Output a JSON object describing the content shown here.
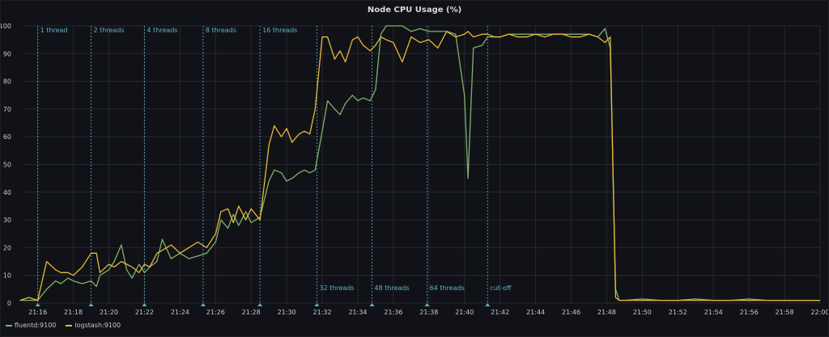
{
  "chart_data": {
    "type": "line",
    "title": "Node CPU Usage (%)",
    "xlabel": "",
    "ylabel": "",
    "xlim": [
      21.2,
      22.0
    ],
    "ylim": [
      0,
      100
    ],
    "yticks": [
      0,
      10,
      20,
      30,
      40,
      50,
      60,
      70,
      80,
      90,
      100
    ],
    "xticks": [
      "21:16",
      "21:18",
      "21:20",
      "21:22",
      "21:24",
      "21:26",
      "21:28",
      "21:30",
      "21:32",
      "21:34",
      "21:36",
      "21:38",
      "21:40",
      "21:42",
      "21:44",
      "21:46",
      "21:48",
      "21:50",
      "21:52",
      "21:54",
      "21:56",
      "21:58",
      "22:00"
    ],
    "grid": true,
    "legend_position": "bottom-left",
    "annotations": [
      {
        "time": "21:16",
        "label": "1 thread",
        "label_pos": "top"
      },
      {
        "time": "21:19",
        "label": "2 threads",
        "label_pos": "top"
      },
      {
        "time": "21:22",
        "label": "4 threads",
        "label_pos": "top"
      },
      {
        "time": "21:25.3",
        "label": "8 threads",
        "label_pos": "top"
      },
      {
        "time": "21:28.5",
        "label": "16 threads",
        "label_pos": "top"
      },
      {
        "time": "21:31.7",
        "label": "32 threads",
        "label_pos": "bottom"
      },
      {
        "time": "21:34.8",
        "label": "48 threads",
        "label_pos": "bottom"
      },
      {
        "time": "21:37.9",
        "label": "64 threads",
        "label_pos": "bottom"
      },
      {
        "time": "21:41.3",
        "label": "cut-off",
        "label_pos": "bottom"
      }
    ],
    "series": [
      {
        "name": "fluentd:9100",
        "color": "#7eb26d",
        "points": [
          [
            "21:15",
            1
          ],
          [
            "21:15.5",
            1
          ],
          [
            "21:16",
            1
          ],
          [
            "21:16.5",
            5
          ],
          [
            "21:17",
            8
          ],
          [
            "21:17.3",
            7
          ],
          [
            "21:17.7",
            9
          ],
          [
            "21:18",
            8
          ],
          [
            "21:18.5",
            7
          ],
          [
            "21:19",
            8
          ],
          [
            "21:19.3",
            6
          ],
          [
            "21:19.5",
            10
          ],
          [
            "21:20",
            12
          ],
          [
            "21:20.3",
            15
          ],
          [
            "21:20.7",
            21
          ],
          [
            "21:21",
            12
          ],
          [
            "21:21.3",
            9
          ],
          [
            "21:21.7",
            14
          ],
          [
            "21:22",
            11
          ],
          [
            "21:22.3",
            13
          ],
          [
            "21:22.7",
            15
          ],
          [
            "21:23",
            23
          ],
          [
            "21:23.5",
            16
          ],
          [
            "21:24",
            18
          ],
          [
            "21:24.5",
            16
          ],
          [
            "21:25",
            17
          ],
          [
            "21:25.5",
            18
          ],
          [
            "21:26",
            22
          ],
          [
            "21:26.3",
            30
          ],
          [
            "21:26.7",
            27
          ],
          [
            "21:27",
            32
          ],
          [
            "21:27.3",
            28
          ],
          [
            "21:27.7",
            33
          ],
          [
            "21:28",
            29
          ],
          [
            "21:28.5",
            31
          ],
          [
            "21:29",
            44
          ],
          [
            "21:29.3",
            48
          ],
          [
            "21:29.7",
            47
          ],
          [
            "21:30",
            44
          ],
          [
            "21:30.3",
            45
          ],
          [
            "21:30.7",
            47
          ],
          [
            "21:31",
            48
          ],
          [
            "21:31.3",
            47
          ],
          [
            "21:31.6",
            48
          ],
          [
            "21:32",
            62
          ],
          [
            "21:32.3",
            73
          ],
          [
            "21:32.7",
            70
          ],
          [
            "21:33",
            68
          ],
          [
            "21:33.3",
            72
          ],
          [
            "21:33.7",
            75
          ],
          [
            "21:34",
            73
          ],
          [
            "21:34.3",
            74
          ],
          [
            "21:34.7",
            73
          ],
          [
            "21:35",
            77
          ],
          [
            "21:35.3",
            97
          ],
          [
            "21:35.6",
            100
          ],
          [
            "21:36",
            100
          ],
          [
            "21:36.5",
            100
          ],
          [
            "21:37",
            98
          ],
          [
            "21:37.5",
            99
          ],
          [
            "21:38",
            98
          ],
          [
            "21:38.5",
            98
          ],
          [
            "21:39",
            98
          ],
          [
            "21:39.5",
            97
          ],
          [
            "21:40",
            75
          ],
          [
            "21:40.2",
            45
          ],
          [
            "21:40.5",
            92
          ],
          [
            "21:41",
            93
          ],
          [
            "21:41.3",
            96
          ],
          [
            "21:41.7",
            96
          ],
          [
            "21:42",
            96
          ],
          [
            "21:42.5",
            97
          ],
          [
            "21:43",
            97
          ],
          [
            "21:43.5",
            97
          ],
          [
            "21:44",
            97
          ],
          [
            "21:44.5",
            97
          ],
          [
            "21:45",
            97
          ],
          [
            "21:45.5",
            97
          ],
          [
            "21:46",
            97
          ],
          [
            "21:46.5",
            97
          ],
          [
            "21:47",
            97
          ],
          [
            "21:47.5",
            96
          ],
          [
            "21:47.9",
            99
          ],
          [
            "21:48.2",
            92
          ],
          [
            "21:48.5",
            5
          ],
          [
            "21:48.7",
            1
          ],
          [
            "21:49",
            1
          ],
          [
            "21:50",
            1.5
          ],
          [
            "21:51",
            1
          ],
          [
            "21:52",
            1
          ],
          [
            "21:53",
            1.5
          ],
          [
            "21:54",
            1
          ],
          [
            "21:55",
            1
          ],
          [
            "21:56",
            1.5
          ],
          [
            "21:57",
            1
          ],
          [
            "21:58",
            1
          ],
          [
            "21:59",
            1
          ],
          [
            "22:00",
            1
          ]
        ]
      },
      {
        "name": "logstash:9100",
        "color": "#eab839",
        "points": [
          [
            "21:15",
            1
          ],
          [
            "21:15.5",
            2
          ],
          [
            "21:16",
            1
          ],
          [
            "21:16.5",
            15
          ],
          [
            "21:17",
            12
          ],
          [
            "21:17.3",
            11
          ],
          [
            "21:17.7",
            11
          ],
          [
            "21:18",
            10
          ],
          [
            "21:18.5",
            13
          ],
          [
            "21:19",
            18
          ],
          [
            "21:19.3",
            18
          ],
          [
            "21:19.5",
            11
          ],
          [
            "21:20",
            14
          ],
          [
            "21:20.3",
            13
          ],
          [
            "21:20.7",
            15
          ],
          [
            "21:21",
            14
          ],
          [
            "21:21.3",
            13
          ],
          [
            "21:21.7",
            11
          ],
          [
            "21:22",
            14
          ],
          [
            "21:22.3",
            13
          ],
          [
            "21:22.7",
            18
          ],
          [
            "21:23",
            19
          ],
          [
            "21:23.5",
            21
          ],
          [
            "21:24",
            18
          ],
          [
            "21:24.5",
            20
          ],
          [
            "21:25",
            22
          ],
          [
            "21:25.5",
            20
          ],
          [
            "21:26",
            25
          ],
          [
            "21:26.3",
            33
          ],
          [
            "21:26.7",
            34
          ],
          [
            "21:27",
            29
          ],
          [
            "21:27.3",
            35
          ],
          [
            "21:27.7",
            30
          ],
          [
            "21:28",
            34
          ],
          [
            "21:28.5",
            30
          ],
          [
            "21:29",
            57
          ],
          [
            "21:29.3",
            64
          ],
          [
            "21:29.7",
            60
          ],
          [
            "21:30",
            63
          ],
          [
            "21:30.3",
            58
          ],
          [
            "21:30.7",
            61
          ],
          [
            "21:31",
            62
          ],
          [
            "21:31.3",
            61
          ],
          [
            "21:31.6",
            70
          ],
          [
            "21:32",
            96
          ],
          [
            "21:32.3",
            96
          ],
          [
            "21:32.7",
            88
          ],
          [
            "21:33",
            91
          ],
          [
            "21:33.3",
            87
          ],
          [
            "21:33.7",
            95
          ],
          [
            "21:34",
            96
          ],
          [
            "21:34.3",
            93
          ],
          [
            "21:34.7",
            91
          ],
          [
            "21:35",
            93
          ],
          [
            "21:35.3",
            96
          ],
          [
            "21:35.6",
            95
          ],
          [
            "21:36",
            94
          ],
          [
            "21:36.5",
            87
          ],
          [
            "21:37",
            96
          ],
          [
            "21:37.5",
            94
          ],
          [
            "21:38",
            95
          ],
          [
            "21:38.5",
            92
          ],
          [
            "21:39",
            98
          ],
          [
            "21:39.5",
            96
          ],
          [
            "21:40",
            97
          ],
          [
            "21:40.2",
            98
          ],
          [
            "21:40.5",
            96
          ],
          [
            "21:41",
            97
          ],
          [
            "21:41.3",
            97
          ],
          [
            "21:41.7",
            96
          ],
          [
            "21:42",
            96
          ],
          [
            "21:42.5",
            97
          ],
          [
            "21:43",
            96
          ],
          [
            "21:43.5",
            96
          ],
          [
            "21:44",
            97
          ],
          [
            "21:44.5",
            96
          ],
          [
            "21:45",
            97
          ],
          [
            "21:45.5",
            97
          ],
          [
            "21:46",
            96
          ],
          [
            "21:46.5",
            96
          ],
          [
            "21:47",
            97
          ],
          [
            "21:47.5",
            96
          ],
          [
            "21:47.9",
            94
          ],
          [
            "21:48.2",
            96
          ],
          [
            "21:48.5",
            2
          ],
          [
            "21:48.7",
            1
          ],
          [
            "21:49",
            1
          ],
          [
            "21:50",
            1
          ],
          [
            "21:51",
            1
          ],
          [
            "21:52",
            1
          ],
          [
            "21:53",
            1
          ],
          [
            "21:54",
            1
          ],
          [
            "21:55",
            1
          ],
          [
            "21:56",
            1
          ],
          [
            "21:57",
            1
          ],
          [
            "21:58",
            1
          ],
          [
            "21:59",
            1
          ],
          [
            "22:00",
            1
          ]
        ]
      }
    ]
  }
}
